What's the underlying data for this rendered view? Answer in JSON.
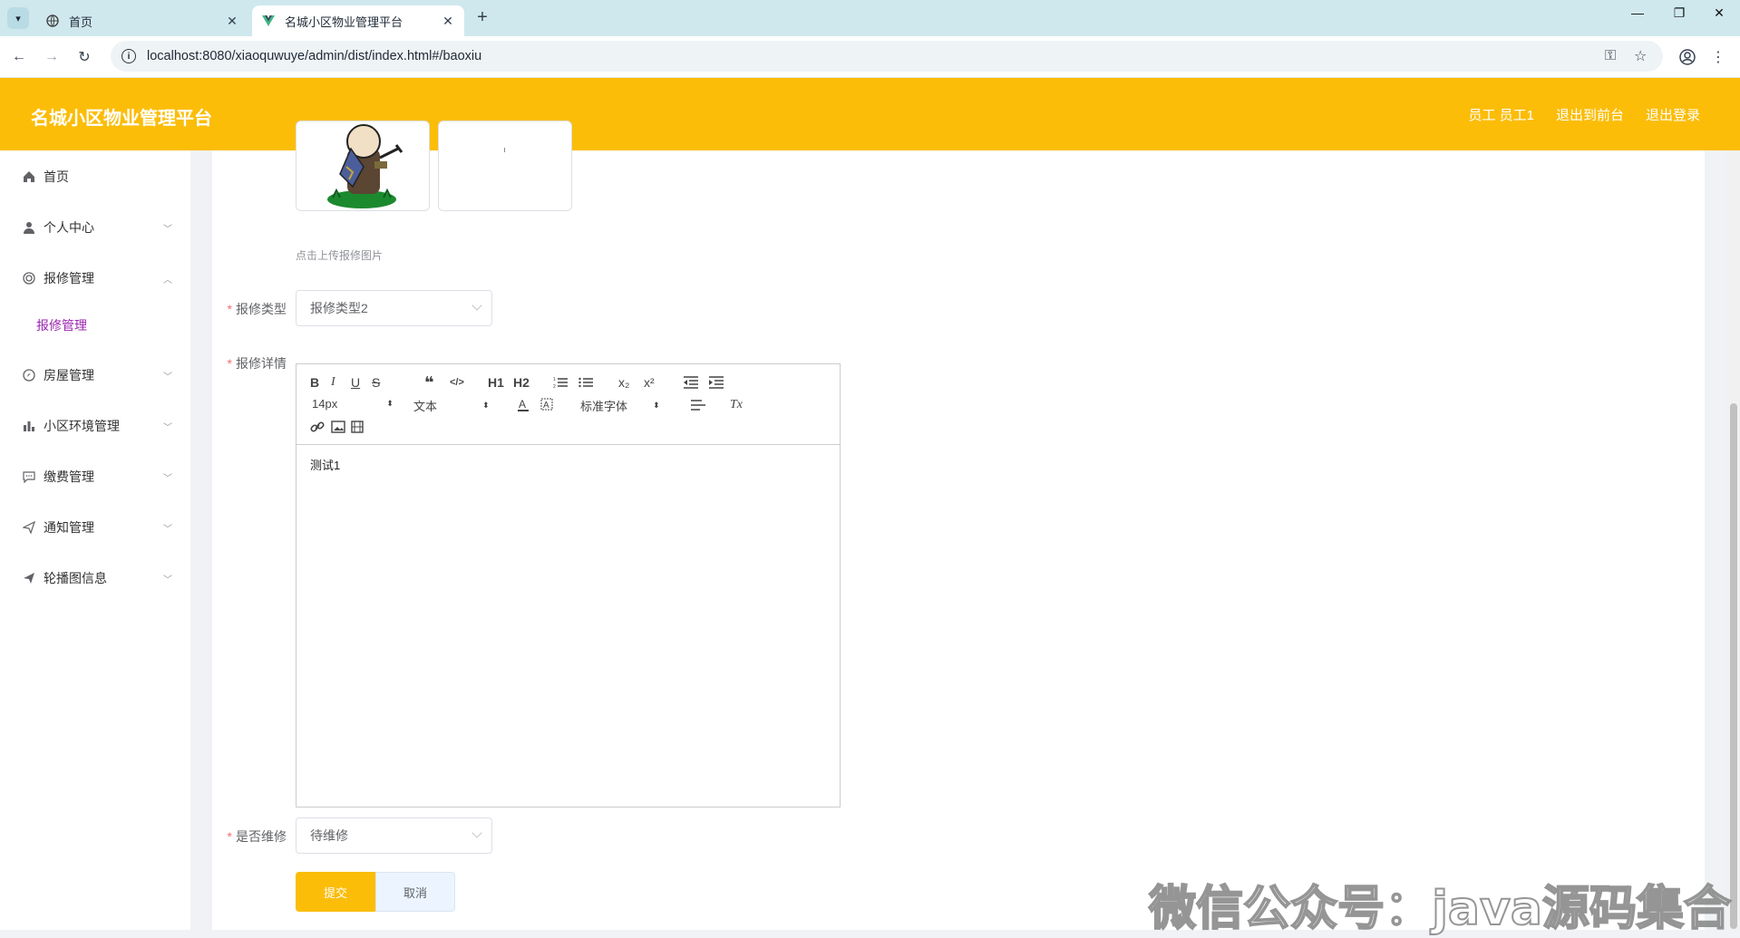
{
  "browser": {
    "tabs": [
      {
        "title": "首页",
        "active": false
      },
      {
        "title": "名城小区物业管理平台",
        "active": true
      }
    ],
    "url": "localhost:8080/xiaoquwuye/admin/dist/index.html#/baoxiu"
  },
  "header": {
    "title": "名城小区物业管理平台",
    "links": [
      "员工 员工1",
      "退出到前台",
      "退出登录"
    ]
  },
  "sidebar": {
    "items": [
      {
        "label": "首页",
        "icon": "home-icon",
        "expandable": false
      },
      {
        "label": "个人中心",
        "icon": "user-icon",
        "expandable": true
      },
      {
        "label": "报修管理",
        "icon": "repair-icon",
        "expandable": true,
        "expanded": true
      },
      {
        "label": "房屋管理",
        "icon": "compass-icon",
        "expandable": true
      },
      {
        "label": "小区环境管理",
        "icon": "bar-chart-icon",
        "expandable": true
      },
      {
        "label": "缴费管理",
        "icon": "chat-icon",
        "expandable": true
      },
      {
        "label": "通知管理",
        "icon": "send-icon",
        "expandable": true
      },
      {
        "label": "轮播图信息",
        "icon": "paper-plane-icon",
        "expandable": true
      }
    ],
    "submenu": {
      "label": "报修管理"
    }
  },
  "form": {
    "upload_hint": "点击上传报修图片",
    "repair_type": {
      "label": "报修类型",
      "value": "报修类型2"
    },
    "repair_detail": {
      "label": "报修详情",
      "content": "测试1"
    },
    "is_repaired": {
      "label": "是否维修",
      "value": "待维修"
    },
    "required_mark": "*",
    "submit": "提交",
    "cancel": "取消"
  },
  "editor": {
    "font_size": "14px",
    "header_picker": "文本",
    "font_family": "标准字体",
    "buttons": [
      "B",
      "I",
      "U",
      "S",
      "❝",
      "</>",
      "H1",
      "H2",
      "x₂",
      "x²",
      "Tx"
    ]
  },
  "watermark": "微信公众号：java源码集合",
  "colors": {
    "brand": "#fbbd08",
    "submenu_active": "#9c27b0",
    "required": "#f56c6c"
  }
}
